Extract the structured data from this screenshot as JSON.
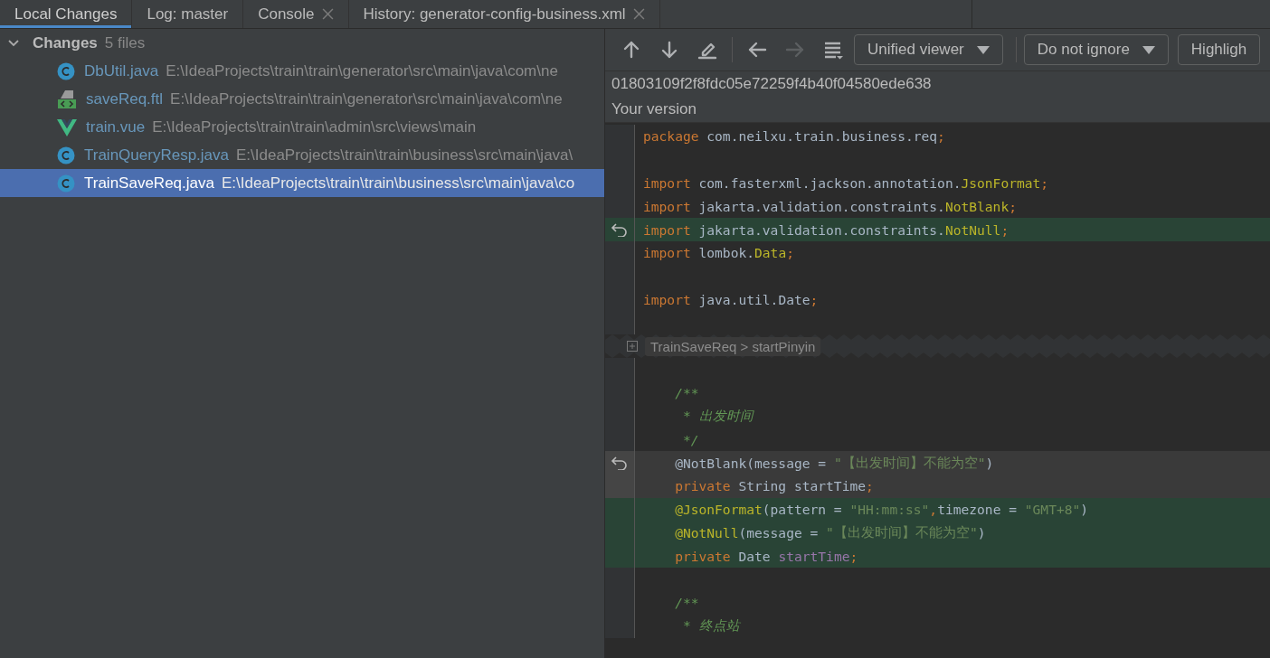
{
  "tabs": [
    {
      "label": "Local Changes",
      "selected": true,
      "closable": false
    },
    {
      "label": "Log: master",
      "selected": false,
      "closable": false
    },
    {
      "label": "Console",
      "selected": false,
      "closable": true
    },
    {
      "label": "History: generator-config-business.xml",
      "selected": false,
      "closable": true
    }
  ],
  "changes": {
    "title": "Changes",
    "count": "5 files",
    "expanded": true,
    "files": [
      {
        "name": "DbUtil.java",
        "path": "E:\\IdeaProjects\\train\\train\\generator\\src\\main\\java\\com\\ne",
        "kind": "java",
        "selected": false
      },
      {
        "name": "saveReq.ftl",
        "path": "E:\\IdeaProjects\\train\\train\\generator\\src\\main\\java\\com\\ne",
        "kind": "template",
        "selected": false
      },
      {
        "name": "train.vue",
        "path": "E:\\IdeaProjects\\train\\train\\admin\\src\\views\\main",
        "kind": "vue",
        "selected": false
      },
      {
        "name": "TrainQueryResp.java",
        "path": "E:\\IdeaProjects\\train\\train\\business\\src\\main\\java\\",
        "kind": "java",
        "selected": false
      },
      {
        "name": "TrainSaveReq.java",
        "path": "E:\\IdeaProjects\\train\\train\\business\\src\\main\\java\\co",
        "kind": "java",
        "selected": true
      }
    ]
  },
  "toolbar": {
    "buttons": [
      {
        "kind": "up",
        "disabled": false
      },
      {
        "kind": "down",
        "disabled": false
      },
      {
        "kind": "edit",
        "disabled": false
      },
      {
        "kind": "back",
        "disabled": false
      },
      {
        "kind": "forward",
        "disabled": true
      },
      {
        "kind": "menu",
        "disabled": false
      }
    ],
    "dropdowns": [
      "Unified viewer",
      "Do not ignore",
      "Highligh"
    ]
  },
  "revision": "01803109f2f8fdc05e72259f4b40f04580ede638",
  "version_label": "Your version",
  "code": [
    {
      "kind": "code",
      "added": false,
      "deleted": false,
      "revert": false,
      "tokens": [
        {
          "kind": "keyword",
          "text": "package "
        },
        {
          "kind": "plain",
          "text": "com.neilxu.train.business.req"
        },
        {
          "kind": "keyword",
          "text": ";"
        }
      ]
    },
    {
      "kind": "code",
      "added": false,
      "deleted": false,
      "revert": false
    },
    {
      "kind": "code",
      "added": false,
      "deleted": false,
      "revert": false,
      "tokens": [
        {
          "kind": "keyword",
          "text": "import "
        },
        {
          "kind": "plain",
          "text": "com.fasterxml.jackson.annotation."
        },
        {
          "kind": "annotation",
          "text": "JsonFormat"
        },
        {
          "kind": "keyword",
          "text": ";"
        }
      ]
    },
    {
      "kind": "code",
      "added": false,
      "deleted": false,
      "revert": false,
      "tokens": [
        {
          "kind": "keyword",
          "text": "import "
        },
        {
          "kind": "plain",
          "text": "jakarta.validation.constraints."
        },
        {
          "kind": "annotation",
          "text": "NotBlank"
        },
        {
          "kind": "keyword",
          "text": ";"
        }
      ]
    },
    {
      "kind": "code",
      "added": true,
      "deleted": false,
      "revert": true,
      "tokens": [
        {
          "kind": "keyword",
          "text": "import "
        },
        {
          "kind": "plain",
          "text": "jakarta.validation.constraints."
        },
        {
          "kind": "annotation",
          "text": "NotNull"
        },
        {
          "kind": "keyword",
          "text": ";"
        }
      ]
    },
    {
      "kind": "code",
      "added": false,
      "deleted": false,
      "revert": false,
      "tokens": [
        {
          "kind": "keyword",
          "text": "import "
        },
        {
          "kind": "plain",
          "text": "lombok."
        },
        {
          "kind": "annotation",
          "text": "Data"
        },
        {
          "kind": "keyword",
          "text": ";"
        }
      ]
    },
    {
      "kind": "code",
      "added": false,
      "deleted": false,
      "revert": false
    },
    {
      "kind": "code",
      "added": false,
      "deleted": false,
      "revert": false,
      "tokens": [
        {
          "kind": "keyword",
          "text": "import "
        },
        {
          "kind": "plain",
          "text": "java.util.Date"
        },
        {
          "kind": "keyword",
          "text": ";"
        }
      ]
    },
    {
      "kind": "code",
      "added": false,
      "deleted": false,
      "revert": false
    },
    {
      "kind": "fold",
      "breadcrumb": "TrainSaveReq > startPinyin"
    },
    {
      "kind": "code",
      "added": false,
      "deleted": false,
      "revert": false
    },
    {
      "kind": "code",
      "added": false,
      "deleted": false,
      "revert": false,
      "tokens": [
        {
          "kind": "comment",
          "text": "    /**"
        }
      ]
    },
    {
      "kind": "code",
      "added": false,
      "deleted": false,
      "revert": false,
      "tokens": [
        {
          "kind": "comment",
          "text": "     * 出发时间"
        }
      ]
    },
    {
      "kind": "code",
      "added": false,
      "deleted": false,
      "revert": false,
      "tokens": [
        {
          "kind": "comment",
          "text": "     */"
        }
      ]
    },
    {
      "kind": "code",
      "added": false,
      "deleted": true,
      "revert": true,
      "tokens": [
        {
          "kind": "plain",
          "text": "    @NotBlank(message = "
        },
        {
          "kind": "string",
          "text": "\"【出发时间】不能为空\""
        },
        {
          "kind": "plain",
          "text": ")"
        }
      ]
    },
    {
      "kind": "code",
      "added": false,
      "deleted": true,
      "revert": false,
      "tokens": [
        {
          "kind": "keyword",
          "text": "    private "
        },
        {
          "kind": "plain",
          "text": "String startTime"
        },
        {
          "kind": "keyword",
          "text": ";"
        }
      ]
    },
    {
      "kind": "code",
      "added": true,
      "deleted": false,
      "revert": false,
      "tokens": [
        {
          "kind": "annotation",
          "text": "    @JsonFormat"
        },
        {
          "kind": "plain",
          "text": "(pattern = "
        },
        {
          "kind": "string",
          "text": "\"HH:mm:ss\""
        },
        {
          "kind": "keyword",
          "text": ","
        },
        {
          "kind": "plain",
          "text": "timezone = "
        },
        {
          "kind": "string",
          "text": "\"GMT+8\""
        },
        {
          "kind": "plain",
          "text": ")"
        }
      ]
    },
    {
      "kind": "code",
      "added": true,
      "deleted": false,
      "revert": false,
      "tokens": [
        {
          "kind": "annotation",
          "text": "    @NotNull"
        },
        {
          "kind": "plain",
          "text": "(message = "
        },
        {
          "kind": "string",
          "text": "\"【出发时间】不能为空\""
        },
        {
          "kind": "plain",
          "text": ")"
        }
      ]
    },
    {
      "kind": "code",
      "added": true,
      "deleted": false,
      "revert": false,
      "tokens": [
        {
          "kind": "keyword",
          "text": "    private "
        },
        {
          "kind": "plain",
          "text": "Date "
        },
        {
          "kind": "field",
          "text": "startTime"
        },
        {
          "kind": "keyword",
          "text": ";"
        }
      ]
    },
    {
      "kind": "code",
      "added": false,
      "deleted": false,
      "revert": false
    },
    {
      "kind": "code",
      "added": false,
      "deleted": false,
      "revert": false,
      "tokens": [
        {
          "kind": "comment",
          "text": "    /**"
        }
      ]
    },
    {
      "kind": "code",
      "added": false,
      "deleted": false,
      "revert": false,
      "tokens": [
        {
          "kind": "comment",
          "text": "     * 终点站"
        }
      ]
    }
  ]
}
